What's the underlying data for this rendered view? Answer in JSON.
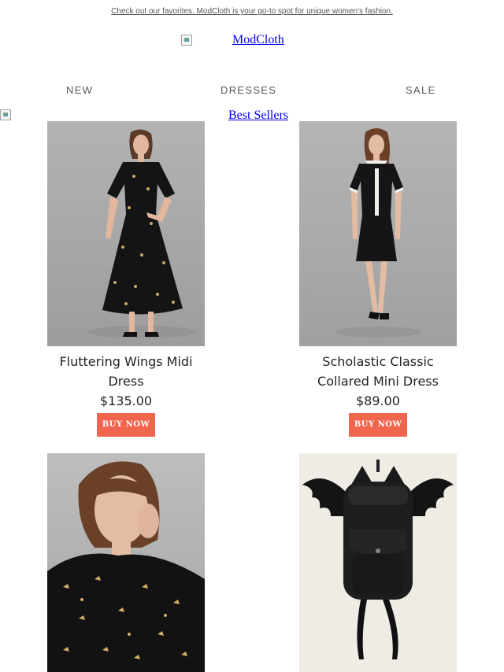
{
  "preheader": {
    "text": "Check out our favorites. ModCloth is your go-to spot for unique women's fashion."
  },
  "logo": {
    "alt_text": "ModCloth"
  },
  "nav": {
    "items": [
      {
        "label": "NEW"
      },
      {
        "label": "DRESSES"
      },
      {
        "label": "SALE"
      }
    ]
  },
  "section": {
    "title": "Best Sellers"
  },
  "products": [
    {
      "name": "Fluttering Wings Midi Dress",
      "price": "$135.00",
      "cta": "BUY NOW"
    },
    {
      "name": "Scholastic Classic Collared Mini Dress",
      "price": "$89.00",
      "cta": "BUY NOW"
    },
    {
      "name": "",
      "price": "",
      "cta": ""
    },
    {
      "name": "",
      "price": "",
      "cta": ""
    }
  ],
  "colors": {
    "buy_button": "#f0654d",
    "link": "#0000ee",
    "nav_text": "#5a5a5a",
    "photo_backdrop": "#a9a9a9"
  }
}
